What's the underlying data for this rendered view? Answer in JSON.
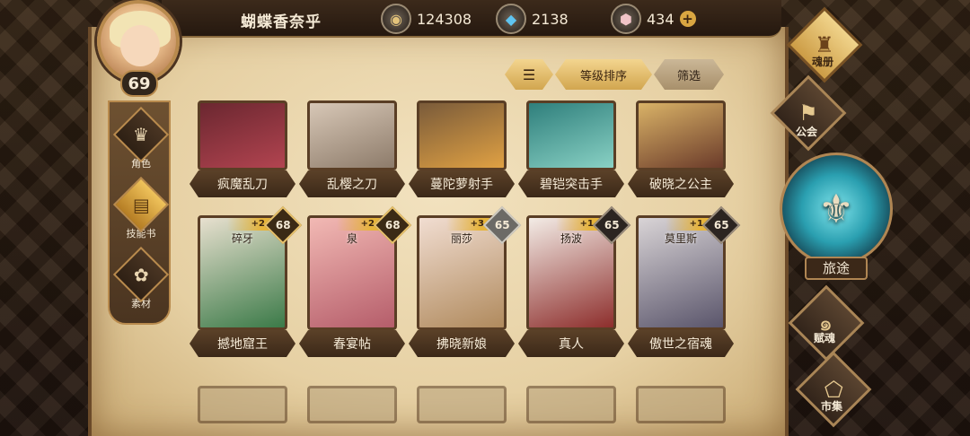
{
  "player": {
    "name": "蝴蝶香奈乎",
    "level": "69"
  },
  "resources": {
    "gold": {
      "icon": "gold-coin-icon",
      "value": "124308"
    },
    "crystal": {
      "icon": "blue-crystal-icon",
      "value": "2138"
    },
    "gem": {
      "icon": "pink-gem-icon",
      "value": "434"
    }
  },
  "sort": {
    "filter_icon": "sort-lines-icon",
    "level_sort_label": "等级排序",
    "filter_label": "筛选"
  },
  "left_nav": [
    {
      "label": "角色",
      "icon": "character-mask-icon",
      "active": false
    },
    {
      "label": "技能书",
      "icon": "skill-book-icon",
      "active": true
    },
    {
      "label": "素材",
      "icon": "material-icon",
      "active": false
    }
  ],
  "cards_row1": [
    {
      "name": "疯魔乱刀",
      "colors": [
        "#6b2730",
        "#b24450"
      ]
    },
    {
      "name": "乱樱之刀",
      "colors": [
        "#d7c7b6",
        "#8d7b6a"
      ]
    },
    {
      "name": "蔓陀萝射手",
      "colors": [
        "#7a5b3a",
        "#e0a143"
      ]
    },
    {
      "name": "碧铠突击手",
      "colors": [
        "#2f7f7c",
        "#89d1c4"
      ]
    },
    {
      "name": "破晓之公主",
      "colors": [
        "#d9b267",
        "#6b3b2a"
      ]
    }
  ],
  "cards_row2": [
    {
      "top_name": "碎牙",
      "name": "撼地窟王",
      "plus": "+2",
      "level": "68",
      "badge": "gold",
      "colors": [
        "#e8e0cf",
        "#3b7a48"
      ]
    },
    {
      "top_name": "泉",
      "name": "春宴帖",
      "plus": "+2",
      "level": "68",
      "badge": "gold",
      "colors": [
        "#f2b9b4",
        "#b55d6a"
      ]
    },
    {
      "top_name": "丽莎",
      "name": "拂晓新娘",
      "plus": "+3",
      "level": "65",
      "badge": "silver",
      "colors": [
        "#f1ddd1",
        "#b08a5d"
      ]
    },
    {
      "top_name": "扬波",
      "name": "真人",
      "plus": "+1",
      "level": "65",
      "badge": "dark",
      "colors": [
        "#f3ece6",
        "#8d2e2c"
      ]
    },
    {
      "top_name": "莫里斯",
      "name": "傲世之宿魂",
      "plus": "+1",
      "level": "65",
      "badge": "dark",
      "colors": [
        "#d9d4d6",
        "#5a556b"
      ]
    }
  ],
  "right_menu": [
    {
      "label": "魂册",
      "icon": "soul-book-icon",
      "active": true
    },
    {
      "label": "公会",
      "icon": "guild-icon",
      "active": false
    },
    {
      "label": "赋魂",
      "icon": "spirit-icon",
      "active": false
    },
    {
      "label": "市集",
      "icon": "market-icon",
      "active": false
    }
  ],
  "journey": {
    "label": "旅途",
    "icon": "journey-compass-icon"
  }
}
